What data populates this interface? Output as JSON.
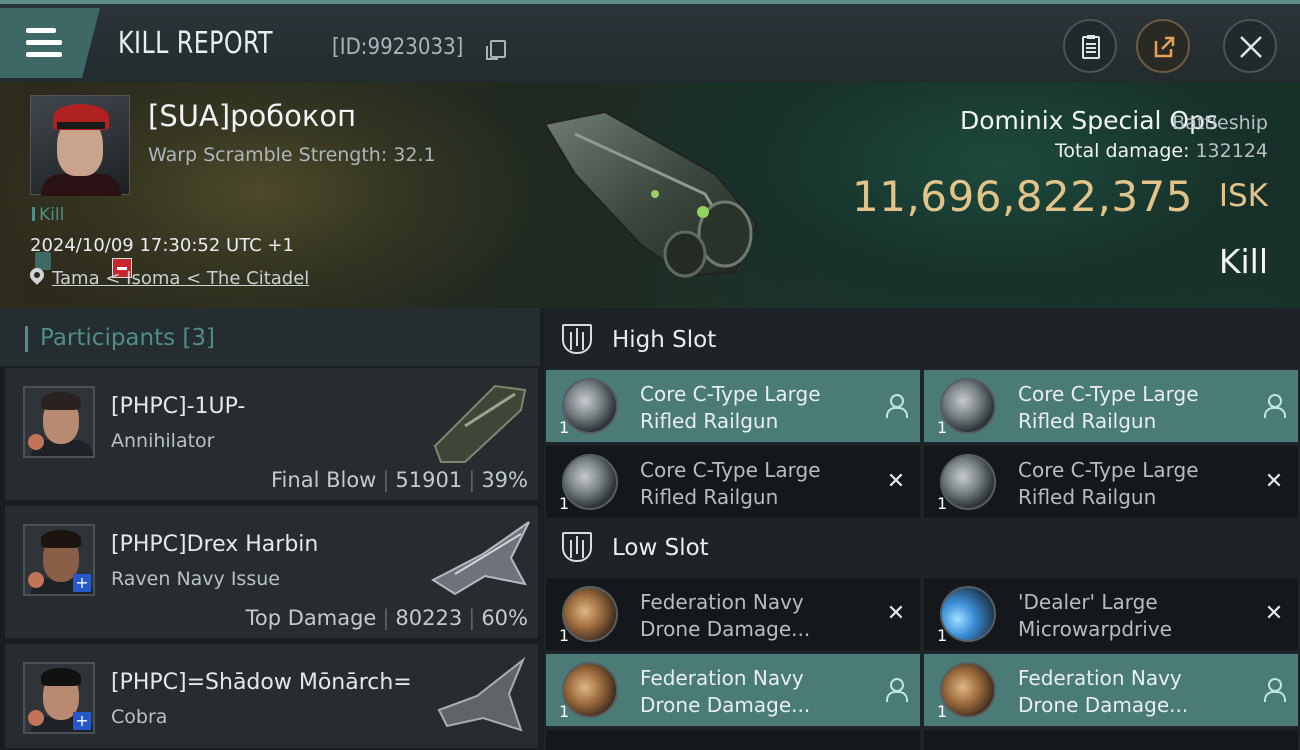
{
  "header": {
    "title": "KILL REPORT",
    "kill_id": "[ID:9923033]"
  },
  "victim": {
    "name": "[SUA]робокоп",
    "warp_scramble": "Warp Scramble Strength: 32.1",
    "tag": "Kill",
    "datetime": "2024/10/09 17:30:52 UTC +1",
    "location": "Tama < Isoma < The Citadel"
  },
  "ship": {
    "name": "Dominix Special Ops",
    "class": "Battleship",
    "total_damage_label": "Total damage:",
    "total_damage": "132124",
    "isk_value": "11,696,822,375",
    "isk_unit": "ISK",
    "result": "Kill"
  },
  "participants": {
    "title": "Participants [3]",
    "items": [
      {
        "name": "[PHPC]-1UP-",
        "ship": "Annihilator",
        "role": "Final Blow",
        "damage": "51901",
        "percent": "39%"
      },
      {
        "name": "[PHPC]Drex Harbin",
        "ship": "Raven Navy Issue",
        "role": "Top Damage",
        "damage": "80223",
        "percent": "60%"
      },
      {
        "name": "[PHPC]=Shādow Mōnārch=",
        "ship": "Cobra",
        "role": "",
        "damage": "",
        "percent": ""
      }
    ]
  },
  "slots": {
    "high": {
      "title": "High Slot",
      "modules": [
        {
          "line1": "Core C-Type Large",
          "line2": "Rifled Railgun",
          "qty": "1",
          "status": "dropped"
        },
        {
          "line1": "Core C-Type Large",
          "line2": "Rifled Railgun",
          "qty": "1",
          "status": "dropped"
        },
        {
          "line1": "Core C-Type Large",
          "line2": "Rifled Railgun",
          "qty": "1",
          "status": "destroyed"
        },
        {
          "line1": "Core C-Type Large",
          "line2": "Rifled Railgun",
          "qty": "1",
          "status": "destroyed"
        }
      ]
    },
    "low": {
      "title": "Low Slot",
      "modules": [
        {
          "line1": "Federation Navy",
          "line2": "Drone Damage...",
          "qty": "1",
          "status": "destroyed"
        },
        {
          "line1": "'Dealer' Large",
          "line2": "Microwarpdrive",
          "qty": "1",
          "status": "destroyed"
        },
        {
          "line1": "Federation Navy",
          "line2": "Drone Damage...",
          "qty": "1",
          "status": "dropped"
        },
        {
          "line1": "Federation Navy",
          "line2": "Drone Damage...",
          "qty": "1",
          "status": "dropped"
        }
      ]
    }
  },
  "colors": {
    "accent_teal": "#4d8e86",
    "isk_gold": "#e2c48a",
    "dropped_bg": "#4a7b77",
    "destroyed_bg": "#14181b"
  },
  "icons": {
    "menu": "hamburger-icon",
    "copy": "copy-icon",
    "clipboard": "clipboard-icon",
    "share": "share-icon",
    "close": "close-icon",
    "location": "location-pin-icon",
    "dropped": "person-icon",
    "destroyed": "x-icon"
  }
}
